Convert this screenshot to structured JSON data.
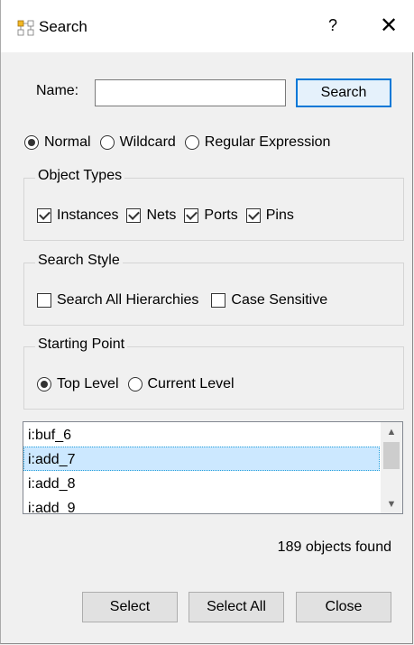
{
  "window": {
    "title": "Search",
    "help_label": "?",
    "close_glyph": "✕"
  },
  "name_row": {
    "label": "Name:",
    "value": "",
    "placeholder": "",
    "search_button": "Search"
  },
  "match_mode": {
    "options": [
      "Normal",
      "Wildcard",
      "Regular Expression"
    ],
    "selected": "Normal"
  },
  "object_types": {
    "title": "Object Types",
    "items": [
      {
        "label": "Instances",
        "checked": true
      },
      {
        "label": "Nets",
        "checked": true
      },
      {
        "label": "Ports",
        "checked": true
      },
      {
        "label": "Pins",
        "checked": true
      }
    ]
  },
  "search_style": {
    "title": "Search Style",
    "items": [
      {
        "label": "Search All Hierarchies",
        "checked": false
      },
      {
        "label": "Case Sensitive",
        "checked": false
      }
    ]
  },
  "starting_point": {
    "title": "Starting Point",
    "options": [
      "Top Level",
      "Current Level"
    ],
    "selected": "Top Level"
  },
  "results": {
    "items": [
      "i:buf_6",
      "i:add_7",
      "i:add_8",
      "i:add_9"
    ],
    "selected_index": 1
  },
  "status": {
    "text": "189 objects found"
  },
  "buttons": {
    "select": "Select",
    "select_all": "Select All",
    "close": "Close"
  }
}
